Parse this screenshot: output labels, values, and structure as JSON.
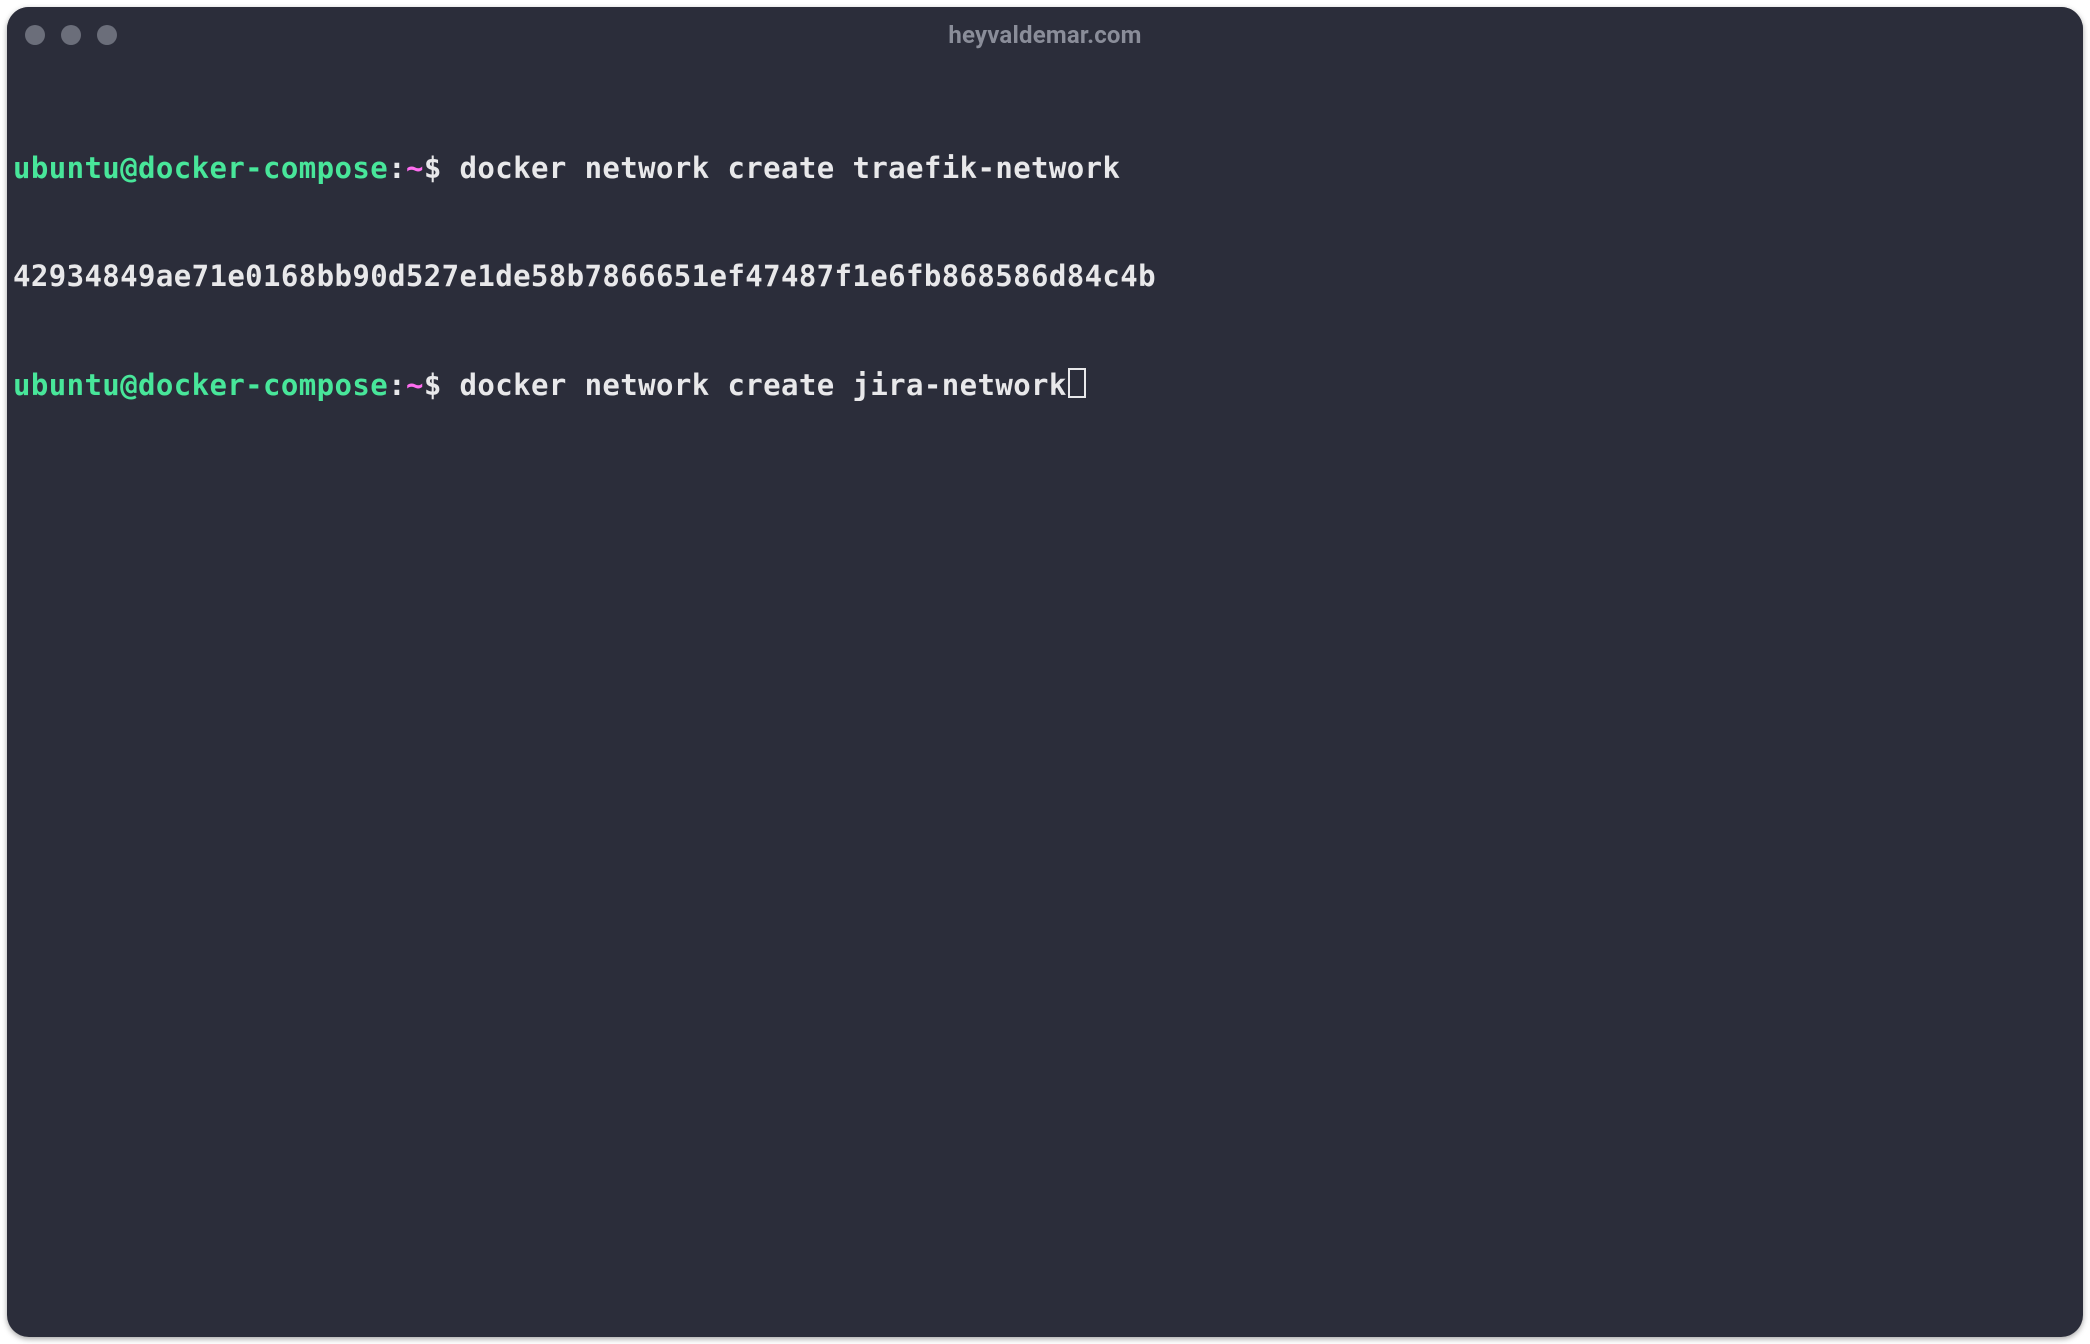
{
  "window": {
    "title": "heyvaldemar.com"
  },
  "prompt": {
    "user_host": "ubuntu@docker-compose",
    "sep": ":",
    "path": "~",
    "sigil": "$"
  },
  "lines": {
    "cmd1": " docker network create traefik-network",
    "out1": "42934849ae71e0168bb90d527e1de58b7866651ef47487f1e6fb868586d84c4b",
    "cmd2": " docker network create jira-network"
  },
  "colors": {
    "bg": "#2b2d3a",
    "text": "#e8e8ea",
    "muted": "#8a8d99",
    "green": "#48e69a",
    "magenta": "#ff6df0"
  }
}
